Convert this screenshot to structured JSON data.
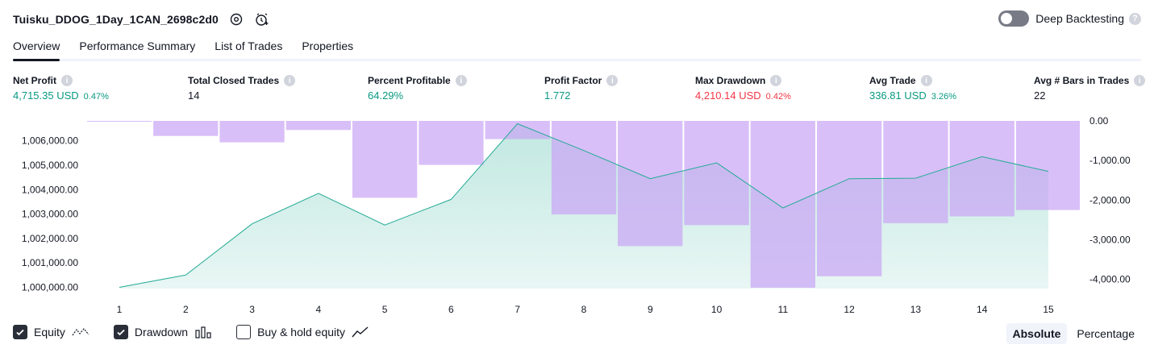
{
  "header": {
    "title": "Tuisku_DDOG_1Day_1CAN_2698c2d0"
  },
  "deep_backtesting": {
    "label": "Deep Backtesting",
    "enabled": false
  },
  "tabs": [
    {
      "label": "Overview",
      "active": true
    },
    {
      "label": "Performance Summary",
      "active": false
    },
    {
      "label": "List of Trades",
      "active": false
    },
    {
      "label": "Properties",
      "active": false
    }
  ],
  "metrics": [
    {
      "label": "Net Profit",
      "value": "4,715.35 USD",
      "pct": "0.47%",
      "color": "#089981"
    },
    {
      "label": "Total Closed Trades",
      "value": "14",
      "pct": "",
      "color": "#131722"
    },
    {
      "label": "Percent Profitable",
      "value": "64.29%",
      "pct": "",
      "color": "#089981"
    },
    {
      "label": "Profit Factor",
      "value": "1.772",
      "pct": "",
      "color": "#089981"
    },
    {
      "label": "Max Drawdown",
      "value": "4,210.14 USD",
      "pct": "0.42%",
      "color": "#f23645"
    },
    {
      "label": "Avg Trade",
      "value": "336.81 USD",
      "pct": "3.26%",
      "color": "#089981"
    },
    {
      "label": "Avg # Bars in Trades",
      "value": "22",
      "pct": "",
      "color": "#131722"
    }
  ],
  "chart_data": {
    "type": "area",
    "x": [
      1,
      2,
      3,
      4,
      5,
      6,
      7,
      8,
      9,
      10,
      11,
      12,
      13,
      14,
      15
    ],
    "left_axis": {
      "ticks": [
        "1,000,000.00",
        "1,001,000.00",
        "1,002,000.00",
        "1,003,000.00",
        "1,004,000.00",
        "1,005,000.00",
        "1,006,000.00"
      ],
      "tick_values": [
        1000000,
        1001000,
        1002000,
        1003000,
        1004000,
        1005000,
        1006000
      ],
      "range": [
        999950,
        1006750
      ]
    },
    "right_axis": {
      "ticks": [
        "0.00",
        "-1,000.00",
        "-2,000.00",
        "-3,000.00",
        "-4,000.00"
      ],
      "tick_values": [
        0,
        -1000,
        -2000,
        -3000,
        -4000
      ],
      "range": [
        -4250,
        0
      ]
    },
    "series": [
      {
        "name": "Equity",
        "type": "area",
        "axis": "left",
        "color": "#22ab94",
        "values": [
          1000000,
          1000500,
          1002600,
          1003850,
          1002550,
          1003600,
          1006700,
          1005600,
          1004450,
          1005100,
          1003250,
          1004450,
          1004470,
          1005350,
          1004750
        ]
      },
      {
        "name": "Drawdown",
        "type": "bar",
        "axis": "right",
        "color": "#c9a4f5",
        "values": [
          -20,
          -380,
          -540,
          -230,
          -1940,
          -1110,
          -460,
          -2360,
          -3160,
          -2630,
          -4210,
          -3920,
          -2580,
          -2410,
          -2250
        ]
      }
    ]
  },
  "legend": [
    {
      "label": "Equity",
      "checked": true,
      "icon": "equity-line-icon"
    },
    {
      "label": "Drawdown",
      "checked": true,
      "icon": "drawdown-bars-icon"
    },
    {
      "label": "Buy & hold equity",
      "checked": false,
      "icon": "buy-hold-line-icon"
    }
  ],
  "scale_switch": {
    "options": [
      "Absolute",
      "Percentage"
    ],
    "active": "Absolute"
  }
}
